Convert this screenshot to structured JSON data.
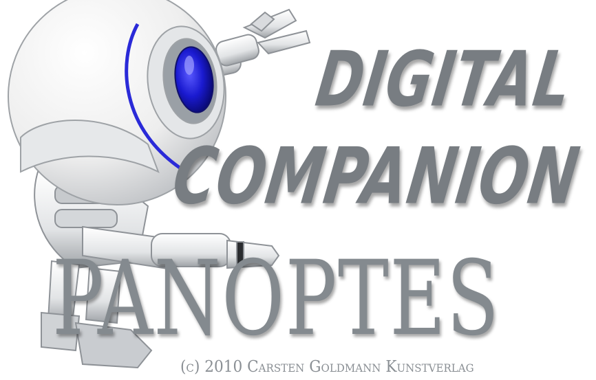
{
  "artwork": {
    "subject": "robot-mascot",
    "colors": {
      "body": "#f2f2f2",
      "shade": "#bfc3c7",
      "lens": "#1c1cc8",
      "accent_ring": "#2a2ad8",
      "text": "#7b8085"
    }
  },
  "heading": {
    "line1": "DIGITAL",
    "line2": "COMPANION"
  },
  "product_name": "PANOPTES",
  "copyright": "(c) 2010 Carsten Goldmann Kunstverlag"
}
